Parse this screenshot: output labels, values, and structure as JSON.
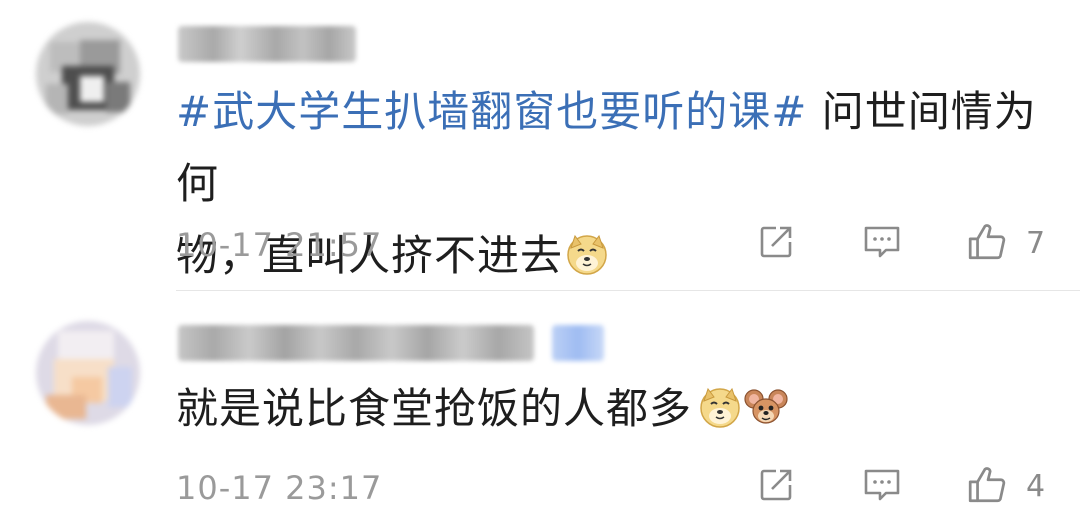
{
  "comments": [
    {
      "hashtag": "#武大学生扒墙翻窗也要听的课#",
      "text_line1_rest": " 问世间情为何",
      "text_line2": "物，直叫人挤不进去",
      "emojis": [
        "doge-emoji"
      ],
      "timestamp": "10-17 21:57",
      "likes": "7"
    },
    {
      "text": "就是说比食堂抢饭的人都多",
      "emojis": [
        "doge-emoji",
        "jerry-emoji"
      ],
      "timestamp": "10-17 23:17",
      "likes": "4"
    }
  ],
  "colors": {
    "hashtag": "#3b6fb6",
    "text": "#1e1e1e",
    "meta": "#9a9a9a",
    "icon": "#8a8a8a",
    "divider": "#e6e6e6"
  }
}
